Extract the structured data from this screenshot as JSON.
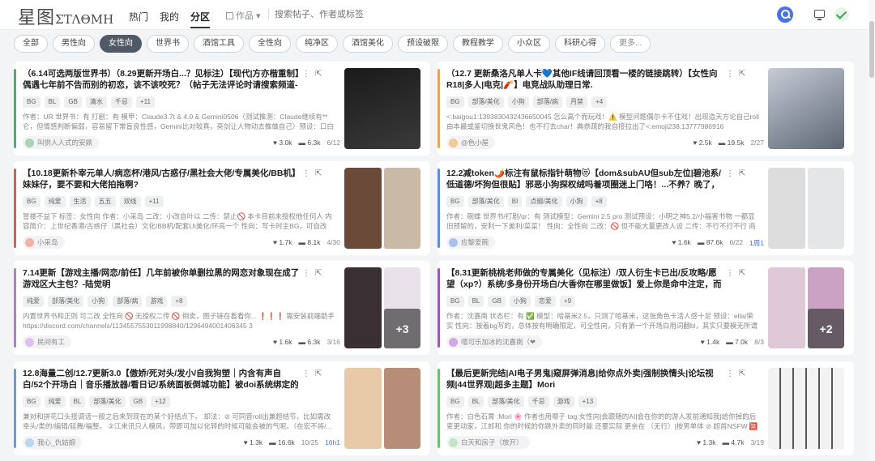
{
  "header": {
    "logo_text": "星图",
    "logo_sub": "ΣΤΛΘΜΗ",
    "nav": [
      "热门",
      "我的",
      "分区"
    ],
    "search_type": "作品",
    "search_placeholder": "搜索帖子、作者或标签"
  },
  "chips": [
    "全部",
    "男性向",
    "女性向",
    "世界书",
    "酒馆工具",
    "全性向",
    "纯净区",
    "酒馆美化",
    "预设破限",
    "教程教学",
    "小众区",
    "科研心得",
    "更多..."
  ],
  "active_chip": "女性向",
  "cards": [
    {
      "title": "（6.14可选两版世界书）（8.29更新开场白...？见标注）【现代|方亦楷重制】偶遇七年前不告而别的初恋，该不该咬死？（帖子无法评论时请搜索频道-狗狗公园）",
      "tags": [
        "BG",
        "BL",
        "GB",
        "清水",
        "千忌",
        "+11"
      ],
      "desc": "作者：UR 世界书：有 打剧：有 模甲：Claude3.7t & 4.0 & Gemini0506（测试推测：Claude继续有**仑，但情感判断偏弱，容易留下常盲良性感，Gemini比对较真，亮剑让人物动去推做自己）预设：口白设。",
      "author": "叫供人人式的安鼎",
      "likes": "3.0k",
      "comments": "6.3k",
      "date": "6/12",
      "bar": "#4cb06d",
      "av": "#a8d5b4"
    },
    {
      "title": "（12.7 更新桑洛凡单人卡💙其他IF线请回顶看一楼的链接跳转）【女性向R18|多人|电克|🧨】电竞战队助理日常.",
      "tags": [
        "BG",
        "部落/美化",
        "小狗",
        "部落/病",
        "月禁",
        "+4"
      ],
      "desc": "<:baigou1:1393830432436650045 怎么高个而玩戏！⚠️ 模型问题偶尔卡不住戏！出现造天方论自己roll由本最或鉴切换世鬼风色！也不打去char！典恭疏的我自接拉出了<:emoji238:13777986916",
      "author": "@色小屋",
      "likes": "2.5k",
      "comments": "19.5k",
      "date": "2/27",
      "bar": "#e8a25a",
      "av": "#f0c997"
    },
    {
      "title": "【10.18更新朴宰元单人/病恋杯/港风/古惑仔/黑社会大佬/专属美化/BB机】妹妹仔，要不要和大佬拍拖啊?",
      "tags": [
        "BG",
        "纯爱",
        "生活",
        "五五",
        "双线",
        "+11"
      ],
      "desc": "冒楼不益下 标签：女性向 作者：小采岛 二改：小改自叶以 二传：禁止🚫 本卡目前未授权他任何人 内容简介：上世纪香港/古惑仔（黑社会）文化/BB机/配套UI美化/环亮一个 性向：写卡时主BG，可自改bl...",
      "author": "小采岛",
      "likes": "1.7k",
      "comments": "8.1k",
      "date": "4/30",
      "bar": "#e05b4f",
      "av": "#f3b1a8"
    },
    {
      "title": "12.2减token🌶️标注有鼠标指针萌物😻【dom&subAU但sub左位|碧池系/低道德/坏狗但很贴】邪恶小狗探权绒吗着项圈迷上门咯！...不养？晚了，开门！-应黎王",
      "tags": [
        "BG",
        "部落/美化",
        "BI",
        "点缀/美化",
        "小狗",
        "+8"
      ],
      "desc": "作者：碗蝶 世界书/打剧/qr：有 测试模型：Gemini 2.5 pro 测试预设：小明之神5.2/小福害书物 一都显旧预留的，安利一下美利/菜菜！ 性向：全性向 二改：🚫 但不能大量更改人设 二传：不行不行不行 商用：...",
      "author": "应黎爱碗",
      "likes": "1.6k",
      "comments": "87.6k",
      "date": "6/22",
      "extra": "1周1",
      "bar": "#5b8de0",
      "av": "#a6c1ee"
    },
    {
      "title": "7.14更新【游戏主播/网恋/前任】几年前被你单删拉黑的网恋对象现在成了游戏区大主包？-陆觉明",
      "tags": [
        "纯爱",
        "部落/美化",
        "小狗",
        "部落/病",
        "游戏",
        "+8"
      ],
      "desc": "内置世界书和正则 可二改 全性向 🚫 无授权二传 🚫 倒卖，图子链在看看你... ❗❗❗ 需安装前端助手 https://discord.com/channels/1134557553011998840/1296494001406345 3",
      "author": "民间有工",
      "likes": "1.6k",
      "comments": "6.3k",
      "date": "3/16",
      "bar": "#b57ad6",
      "av": "#dcc0ee"
    },
    {
      "title": "【8.31更新桃桃老师做的专属美化（见标注）/双人衍生卡已出/反攻略/愿望（xp?）系统/多身份开场白/大香你在哪里做饭】爱上你是命中注定，而不是因系统而起",
      "tags": [
        "BG",
        "BL",
        "GB",
        "小狗",
        "恋爱",
        "+9"
      ],
      "desc": "作者：沈嘉南 状态栏：有 ✅ 模型：哈基米2.5，只测了哈基米，这张角色卡活人感十足 预设：ella/荣实 性向：按着bg写的，总体按有明确限定，可全性向，只有第一个开场白用词翻bl，其实只要模无所谓的对真...",
      "author": "嘻可乐加冰的沈嘉南（❤",
      "likes": "1.4k",
      "comments": "7.0k",
      "date": "8/3",
      "bar": "#9b59b6",
      "av": "#d3a6e6"
    },
    {
      "title": "12.8海量二创/12.7更新3.0【傲娇/死对头/发小/自我狗塑｜内含有声自白/52个开场白｜音乐播放器/看日记/系统面板倒城功能】被doi系统绑定的死对头发小⁉️😵-江来讯",
      "tags": [
        "BG",
        "纯爱",
        "BL",
        "部落/美化",
        "GB",
        "+12"
      ],
      "desc": "兼对和拼花口头接调话一般之后来到现在的某个好结点下。 却法：⊘ 可同音roll出兼超结节，比如需改幸头/类的/编辑/延舞/福整。 ②江来讯只人模风，带即可加以化转的时候可能会被的气呢。（在宏不将/...",
      "author": "我心_仇姑娘",
      "likes": "1.3k",
      "comments": "16.6k",
      "date": "10/25",
      "extra": "16h1",
      "bar": "#5aa0e0",
      "av": "#b8d7f2"
    },
    {
      "title": "【最后更新完结|AI电子男鬼|窥屏弹消息|给你点外卖|强制换情头|论坛视频|44世界观|超多主题】Mori",
      "tags": [
        "BG",
        "BL",
        "部落/美化",
        "千忌",
        "游戏",
        "+13"
      ],
      "desc": "作者：白色石膏 :Mori 🌸 作者也用嗯子 tag:女性向|会跟随的AI|会在你的的游人发前通知我|给你掉的后变更动家，江郎和 你的时候的你跳外卖的同时能 还要实际 更亲在 （无行）|按男单体 ⊘ 超首NSFW 🈲",
      "author": "白天和房子（放开）",
      "likes": "1.3k",
      "comments": "4.7k",
      "date": "3/19",
      "bar": "#6ec06e",
      "av": "#c3e6c3"
    }
  ]
}
